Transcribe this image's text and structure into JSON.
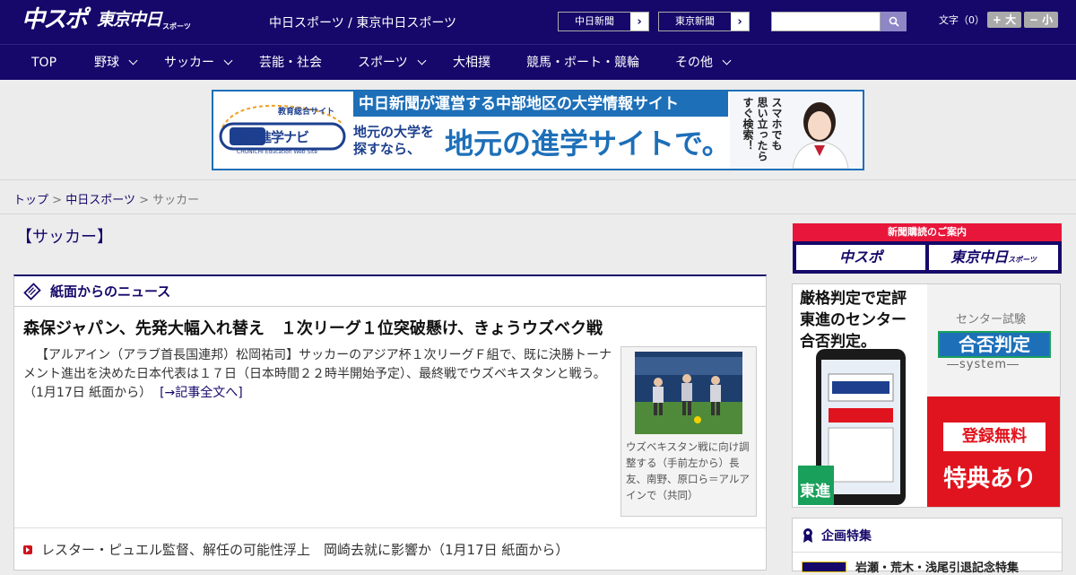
{
  "header": {
    "logo_chuspo": "中スポ",
    "logo_tokyo": "東京中日",
    "logo_tokyo_sub": "スポーツ",
    "site_names": "中日スポーツ / 東京中日スポーツ",
    "btn_chunichi": "中日新聞",
    "btn_tokyo": "東京新聞",
    "search_placeholder": "",
    "font_size_label": "文字（0）",
    "font_larger": "+ 大",
    "font_smaller": "− 小"
  },
  "nav": {
    "items": [
      {
        "label": "TOP",
        "dropdown": false
      },
      {
        "label": "野球",
        "dropdown": true
      },
      {
        "label": "サッカー",
        "dropdown": true
      },
      {
        "label": "芸能・社会",
        "dropdown": false
      },
      {
        "label": "スポーツ",
        "dropdown": true
      },
      {
        "label": "大相撲",
        "dropdown": false
      },
      {
        "label": "競馬・ボート・競輪",
        "dropdown": false
      },
      {
        "label": "その他",
        "dropdown": true
      }
    ]
  },
  "banner": {
    "logo_top": "教育総合サイト",
    "logo_main": "中日進学ナビ",
    "logo_sub": "CHUNICHI Education Web Site",
    "top_text": "中日新聞が運営する中部地区の大学情報サイト",
    "left_text_1": "地元の大学を",
    "left_text_2": "探すなら、",
    "main_text": "地元の進学サイトで。",
    "vertical_1": "スマホでも",
    "vertical_2": "思い立ったら",
    "vertical_3": "すぐ検索！"
  },
  "breadcrumb": {
    "home": "トップ",
    "sep": ">",
    "section": "中日スポーツ",
    "current": "サッカー"
  },
  "page_heading": "【サッカー】",
  "news": {
    "section_title": "紙面からのニュース",
    "headline": "森保ジャパン、先発大幅入れ替え　１次リーグ１位突破懸け、きょうウズベク戦",
    "body": "【アルアイン（アラブ首長国連邦）松岡祐司】サッカーのアジア杯１次リーグＦ組で、既に決勝トーナメント進出を決めた日本代表は１７日（日本時間２２時半開始予定）、最終戦でウズベキスタンと戦う。（1月17日 紙面から）",
    "more_link": "[→記事全文へ]",
    "photo_caption": "ウズベキスタン戦に向け調整する（手前左から）長友、南野、原口ら＝アルアインで（共同）",
    "sub_item": "レスター・ピュエル監督、解任の可能性浮上　岡崎去就に影響か（1月17日 紙面から）"
  },
  "sidebar": {
    "subscribe_title": "新聞購読のご案内",
    "subscribe_chuspo": "中スポ",
    "subscribe_tokyo": "東京中日",
    "subscribe_tokyo_sub": "スポーツ",
    "ad_line1": "厳格判定で定評",
    "ad_line2": "東進のセンター",
    "ad_line3": "合否判定。",
    "ad_center_exam": "センター試験",
    "ad_goukaku": "合否判定",
    "ad_system": "―system―",
    "ad_register": "登録無料",
    "ad_tokuten": "特典あり",
    "ad_toshin": "東進",
    "feature_title": "企画特集",
    "feature_item": "岩瀬・荒木・浅尾引退記念特集"
  },
  "colors": {
    "brand_navy": "#15086a",
    "accent_red": "#d0121b",
    "banner_blue": "#1d6fb8"
  }
}
